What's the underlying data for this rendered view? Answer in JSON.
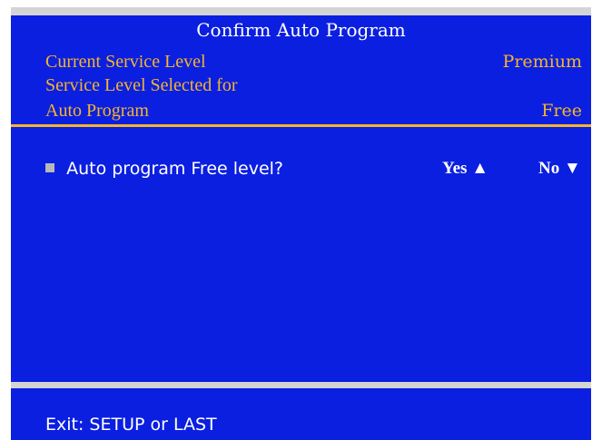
{
  "dialog": {
    "title": "Confirm Auto Program",
    "current_service_level_label": "Current Service Level",
    "current_service_level_value": "Premium",
    "selected_level_label_line1": "Service Level Selected for",
    "selected_level_label_line2": "Auto Program",
    "selected_level_value": "Free",
    "question": "Auto program Free level?",
    "option_yes": "Yes ▲",
    "option_no": "No ▼"
  },
  "footer": {
    "exit_hint": "Exit: SETUP or LAST"
  },
  "colors": {
    "panel_blue": "#0b1fe0",
    "accent_gold": "#f5b52a",
    "frame_gray": "#d4d4d4"
  }
}
